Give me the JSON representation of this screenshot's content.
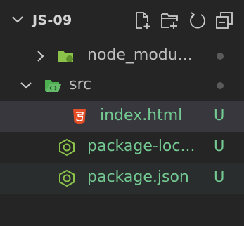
{
  "explorer": {
    "folder_title": "JS-09"
  },
  "tree": [
    {
      "label": "node_modu...",
      "status": ""
    },
    {
      "label": "src",
      "status": ""
    },
    {
      "label": "index.html",
      "status": "U"
    },
    {
      "label": "package-loc...",
      "status": "U"
    },
    {
      "label": "package.json",
      "status": "U"
    }
  ],
  "colors": {
    "background": "#252526",
    "selected_row": "#37373d",
    "untracked": "#73c991",
    "html_icon": "#e44d26",
    "node_icon": "#8bc34a",
    "src_folder_icon": "#4caf50"
  }
}
